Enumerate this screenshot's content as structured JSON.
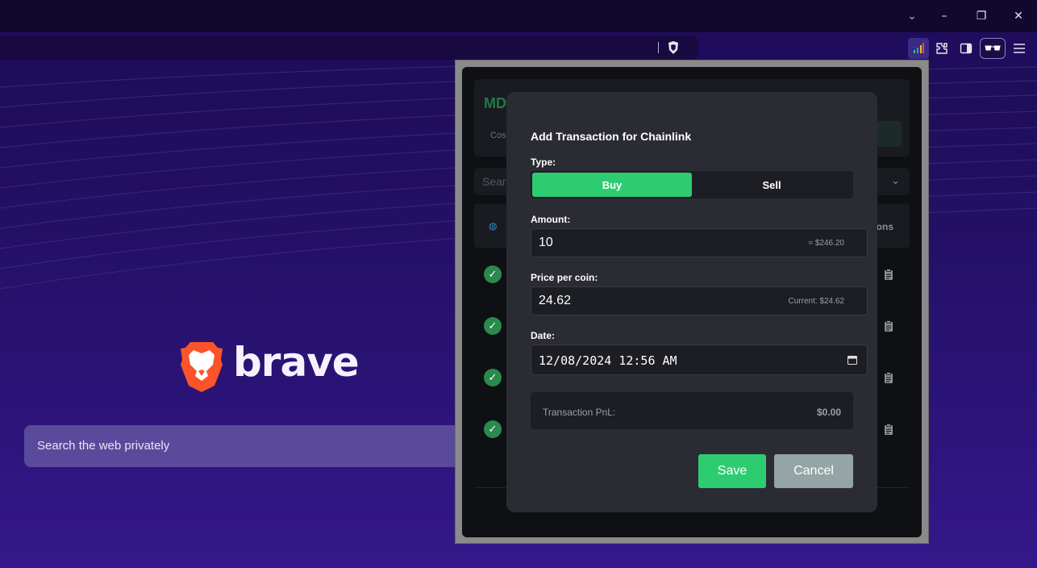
{
  "browser": {
    "title_controls": {
      "tab_search": "⌄",
      "minimize": "–",
      "restore": "❐",
      "close": "✕"
    },
    "toolbar_icons": [
      "crypto-extension-icon",
      "extensions-icon",
      "sidebar-icon",
      "private-glasses-icon",
      "menu-icon"
    ]
  },
  "newtab": {
    "logo_text": "brave",
    "search_placeholder": "Search the web privately"
  },
  "popup": {
    "header_title": "MD",
    "header_cost": "Cost",
    "search_placeholder": "Sear",
    "actions_col": "ons",
    "row_count": 4
  },
  "modal": {
    "title": "Add Transaction for Chainlink",
    "type_label": "Type:",
    "buy_label": "Buy",
    "sell_label": "Sell",
    "selected_type": "Buy",
    "amount_label": "Amount:",
    "amount_value": "10",
    "amount_hint": "≈ $246.20",
    "price_label": "Price per coin:",
    "price_value": "24.62",
    "price_hint": "Current: $24.62",
    "date_label": "Date:",
    "date_value": "12/08/2024 12:56 AM",
    "pnl_label": "Transaction PnL:",
    "pnl_value": "$0.00",
    "save_label": "Save",
    "cancel_label": "Cancel"
  },
  "colors": {
    "accent_green": "#2ecc71",
    "cancel_gray": "#95a5a6",
    "modal_bg": "#2b2c33",
    "page_bg": "#231066"
  }
}
